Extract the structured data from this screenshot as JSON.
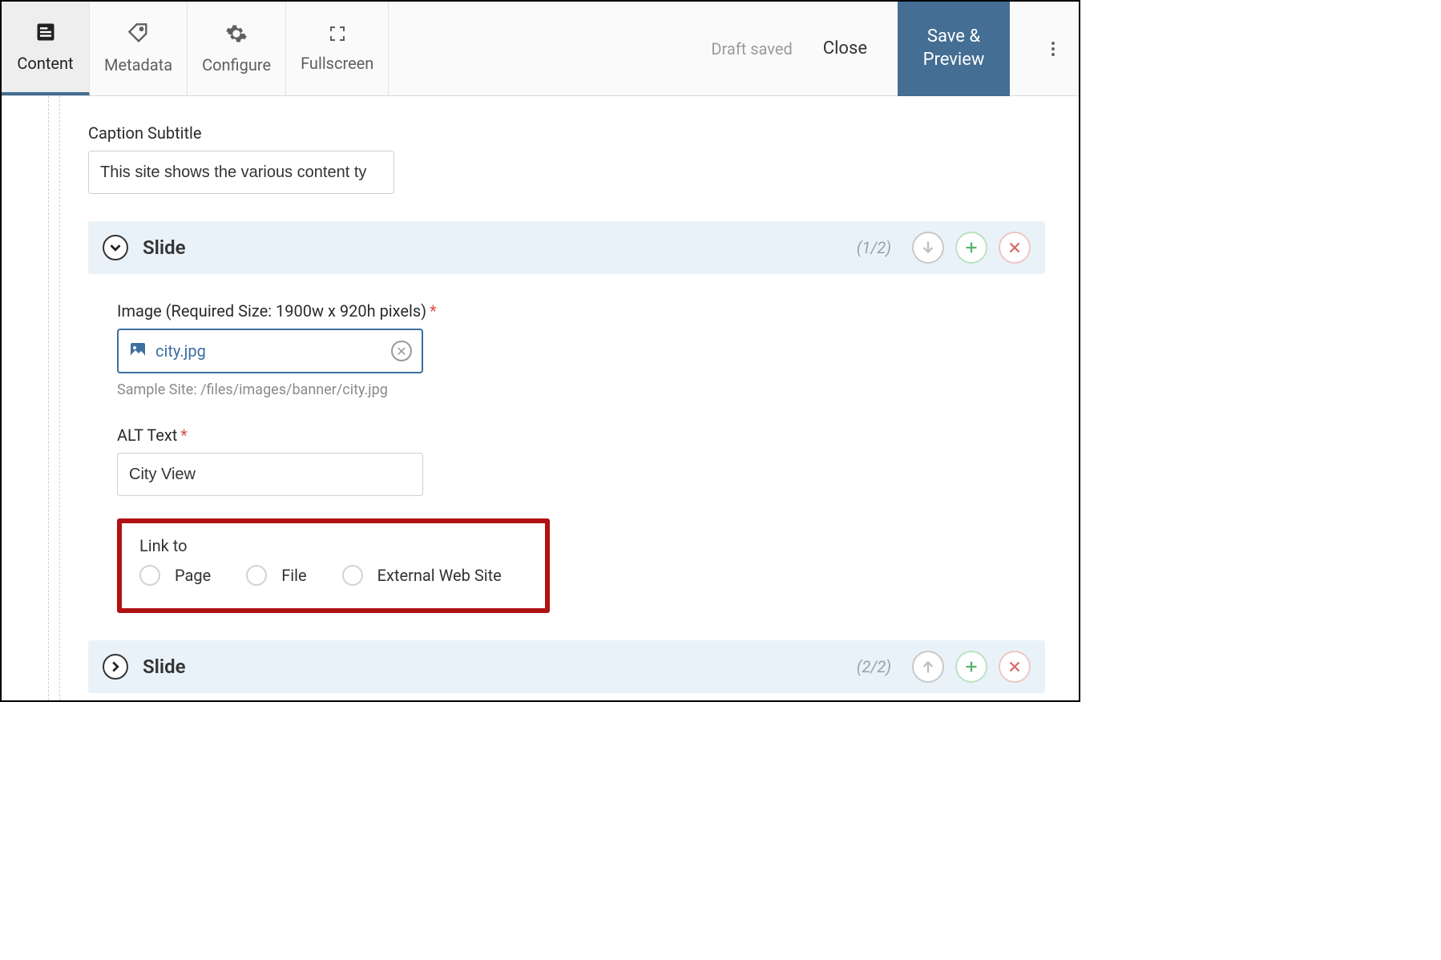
{
  "toolbar": {
    "tabs": {
      "content": "Content",
      "metadata": "Metadata",
      "configure": "Configure",
      "fullscreen": "Fullscreen"
    },
    "draft_status": "Draft saved",
    "close_label": "Close",
    "save_line1": "Save &",
    "save_line2": "Preview"
  },
  "caption_subtitle": {
    "label": "Caption Subtitle",
    "value": "This site shows the various content ty"
  },
  "slides": [
    {
      "title": "Slide",
      "counter": "(1/2)",
      "expanded": true,
      "image": {
        "label": "Image (Required Size: 1900w x 920h pixels)",
        "filename": "city.jpg",
        "path_hint": "Sample Site: /files/images/banner/city.jpg"
      },
      "alt": {
        "label": "ALT Text",
        "value": "City View"
      },
      "link": {
        "label": "Link to",
        "options": {
          "page": "Page",
          "file": "File",
          "external": "External Web Site"
        }
      }
    },
    {
      "title": "Slide",
      "counter": "(2/2)",
      "expanded": false
    }
  ]
}
